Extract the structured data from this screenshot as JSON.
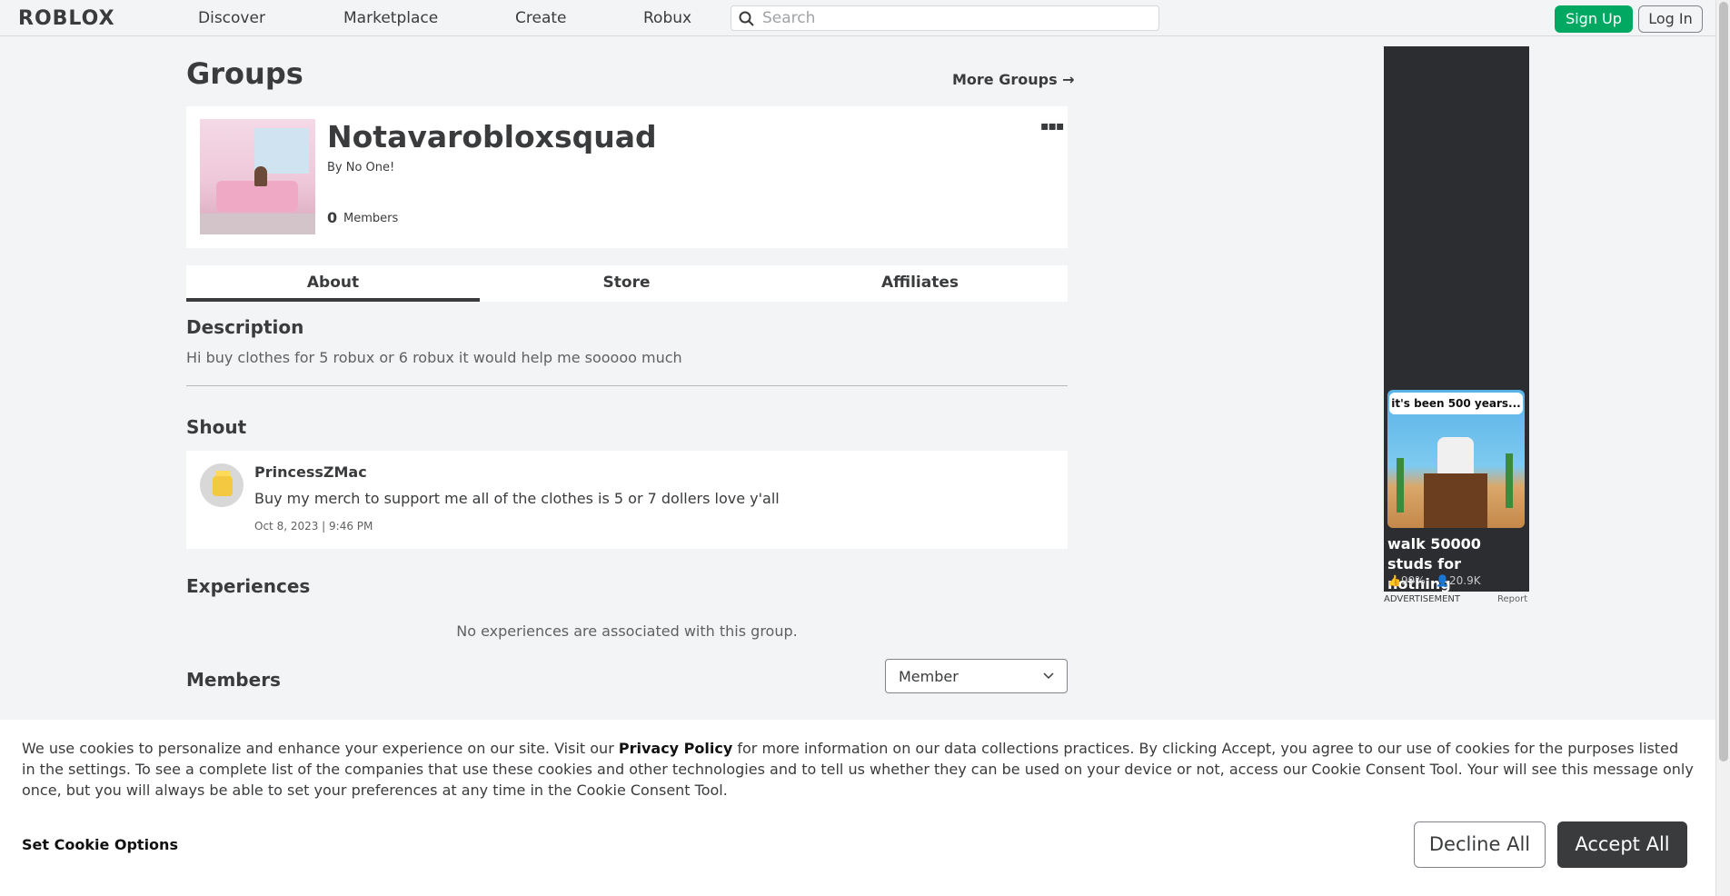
{
  "nav": {
    "logo": "ROBLOX",
    "links": [
      "Discover",
      "Marketplace",
      "Create",
      "Robux"
    ],
    "search_placeholder": "Search",
    "signup": "Sign Up",
    "login": "Log In"
  },
  "page": {
    "title": "Groups",
    "more_groups": "More Groups →"
  },
  "group": {
    "name": "Notavarobloxsquad",
    "by": "By No One!",
    "members_count": "0",
    "members_label": "Members",
    "more_icon": "more-options-icon"
  },
  "tabs": [
    "About",
    "Store",
    "Affiliates"
  ],
  "about": {
    "description_title": "Description",
    "description": "Hi buy clothes for 5 robux or 6 robux it would help me sooooo much",
    "shout_title": "Shout",
    "shout": {
      "user": "PrincessZMac",
      "text": "Buy my merch to support me all of the clothes is 5 or 7 dollers love y'all",
      "date": "Oct 8, 2023 | 9:46 PM"
    },
    "experiences_title": "Experiences",
    "no_experiences": "No experiences are associated with this group.",
    "members_title": "Members",
    "role_select": "Member"
  },
  "ad": {
    "bubble": "it's been 500 years...",
    "title": "walk 50000 studs for nothing",
    "rating": "99%",
    "players": "20.9K",
    "label": "ADVERTISEMENT",
    "report": "Report"
  },
  "cookie": {
    "text_before": "We use cookies to personalize and enhance your experience on our site. Visit our ",
    "privacy_link": "Privacy Policy",
    "text_after": " for more information on our data collections practices. By clicking Accept, you agree to our use of cookies for the purposes listed in the settings. To see a complete list of the companies that use these cookies and other technologies and to tell us whether they can be used on your device or not, access our Cookie Consent Tool. Your will see this message only once, but you will always be able to set your preferences at any time in the Cookie Consent Tool.",
    "options": "Set Cookie Options",
    "decline": "Decline All",
    "accept": "Accept All"
  },
  "colors": {
    "signup_green": "#00a862",
    "accept_dark": "#393b3d",
    "background": "#f2f4f5"
  }
}
